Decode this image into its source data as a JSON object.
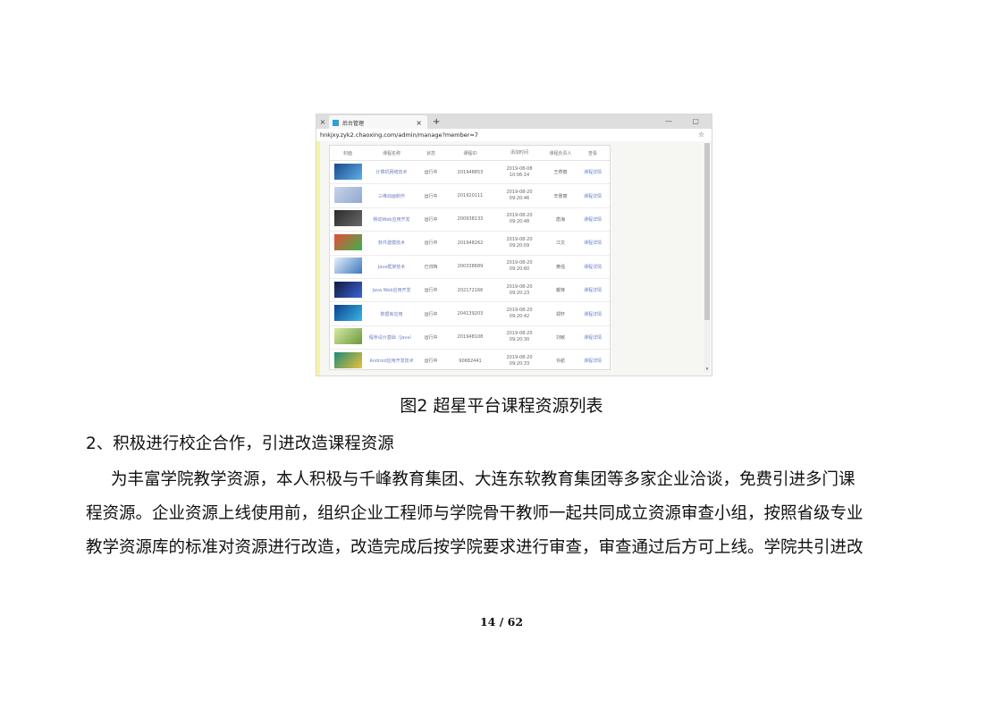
{
  "browser": {
    "tab_title": "后台管理",
    "url": "hnkjxy.zyk2.chaoxing.com/admin/manage?member=7",
    "tab_close": "×",
    "tab_new": "+",
    "win_controls": "— ▢",
    "star": "☆"
  },
  "table": {
    "headers": [
      "封面",
      "课程名称",
      "状态",
      "课程ID",
      "添加时间",
      "课程负责人",
      "查看"
    ],
    "rows": [
      {
        "name": "计算机网络技术",
        "status": "运行中",
        "id": "201948853",
        "date": "2019-08-08",
        "time": "10:06:14",
        "owner": "王燕丽",
        "action": "课程详情",
        "thumb": [
          "#1a4a8a",
          "#5fb0e8"
        ]
      },
      {
        "name": "三维动画制作",
        "status": "运行中",
        "id": "201920111",
        "date": "2019-08-20",
        "time": "09:20:46",
        "owner": "辛惠丽",
        "action": "课程详情",
        "thumb": [
          "#c9d4e8",
          "#8fa8d0"
        ]
      },
      {
        "name": "移动Web应用开发",
        "status": "运行中",
        "id": "200938133",
        "date": "2019-08-20",
        "time": "09:20:48",
        "owner": "唐海",
        "action": "课程详情",
        "thumb": [
          "#2b2b2b",
          "#6a6a6a"
        ]
      },
      {
        "name": "软件建模技术",
        "status": "运行中",
        "id": "201948262",
        "date": "2019-08-20",
        "time": "09:20:09",
        "owner": "江文",
        "action": "课程详情",
        "thumb": [
          "#e84a3c",
          "#3cb24a"
        ]
      },
      {
        "name": "Java框架技术",
        "status": "已归档",
        "id": "200338689",
        "date": "2019-08-20",
        "time": "09:20:60",
        "owner": "黄强",
        "action": "课程详情",
        "thumb": [
          "#e8f0f8",
          "#3a78c0"
        ]
      },
      {
        "name": "Java Web应用开发",
        "status": "运行中",
        "id": "202172166",
        "date": "2019-08-20",
        "time": "09:20:23",
        "owner": "戴锋",
        "action": "课程详情",
        "thumb": [
          "#111a3a",
          "#3a64d8"
        ]
      },
      {
        "name": "数据库应用",
        "status": "运行中",
        "id": "204139203",
        "date": "2019-08-20",
        "time": "09:20:42",
        "owner": "郑轩",
        "action": "课程详情",
        "thumb": [
          "#0d3f8a",
          "#38b8e8"
        ]
      },
      {
        "name": "程序设计基础（Java）",
        "status": "运行中",
        "id": "201948108",
        "date": "2019-08-20",
        "time": "09:20:30",
        "owner": "刘敏",
        "action": "课程详情",
        "thumb": [
          "#d8e8a8",
          "#6a9a3a"
        ]
      },
      {
        "name": "Android应用开发技术",
        "status": "运行中",
        "id": "90682441",
        "date": "2019-08-20",
        "time": "09:20:33",
        "owner": "许航",
        "action": "课程详情",
        "thumb": [
          "#1f8a7a",
          "#e8c23a"
        ]
      }
    ]
  },
  "caption": "图2  超星平台课程资源列表",
  "heading": "2、积极进行校企合作，引进改造课程资源",
  "paragraph": [
    "为丰富学院教学资源，本人积极与千峰教育集团、大连东软教育集团等多家企业洽谈，免费引进多门课",
    "程资源。企业资源上线使用前，组织企业工程师与学院骨干教师一起共同成立资源审查小组，按照省级专业",
    "教学资源库的标准对资源进行改造，改造完成后按学院要求进行审查，审查通过后方可上线。学院共引进改"
  ],
  "page_number": "14 / 62"
}
